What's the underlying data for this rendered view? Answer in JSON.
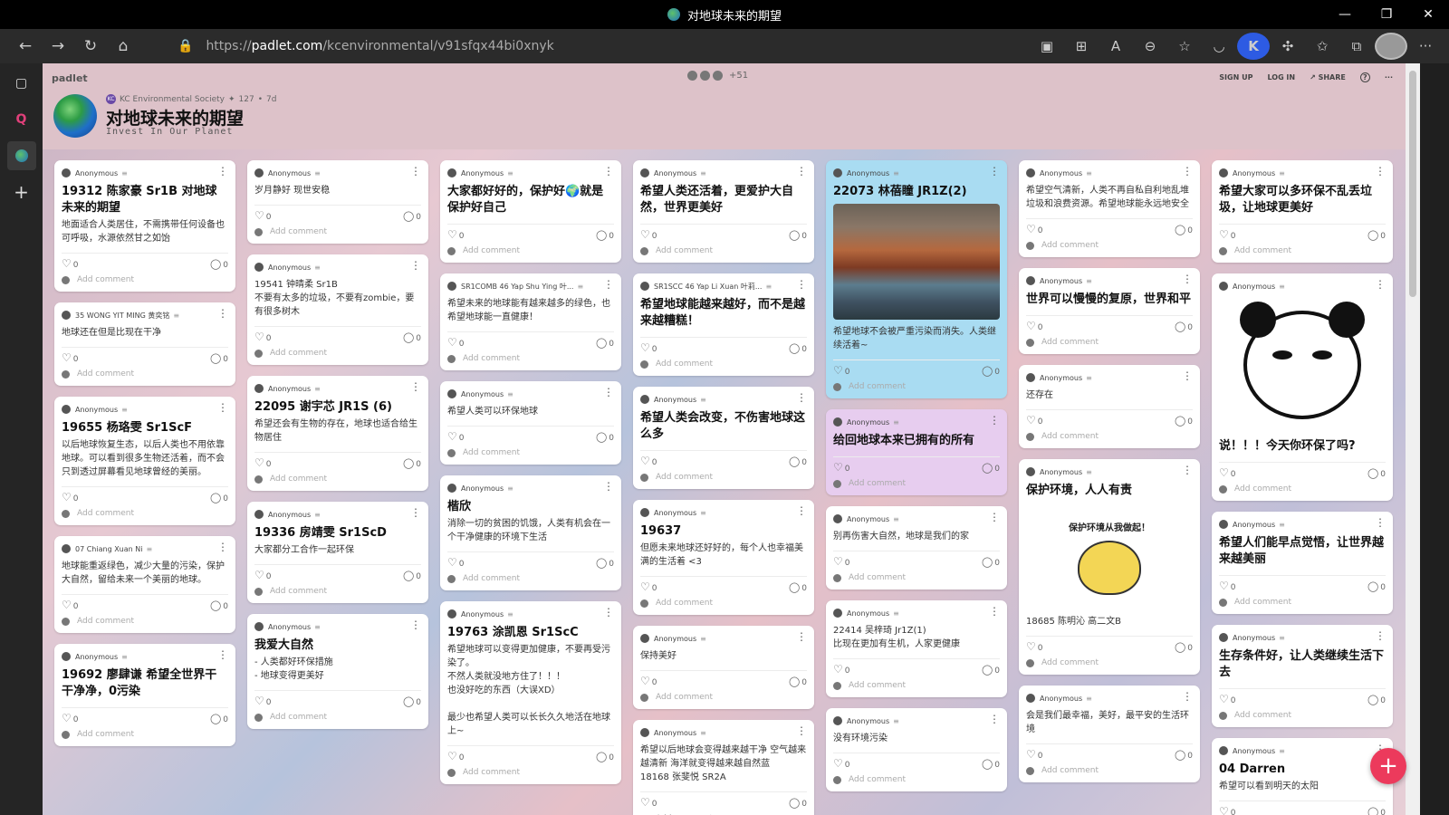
{
  "window": {
    "title": "对地球未来的期望",
    "controls": [
      "—",
      "❐",
      "✕"
    ]
  },
  "browser": {
    "url_prefix": "https://",
    "url_host": "padlet.com",
    "url_path": "/kcenvironmental/v91sfqx44bi0xnyk",
    "back": "←",
    "forward": "→",
    "reload": "↻",
    "home": "⌂",
    "lock": "🔒",
    "menu": "···"
  },
  "sidebar": {
    "tabs": [
      "▢",
      "Q",
      "●"
    ],
    "add": "+"
  },
  "header": {
    "brand": "padlet",
    "contrib_count": "+51",
    "actions": {
      "signup": "SIGN UP",
      "login": "LOG IN",
      "share": "SHARE",
      "help": "?",
      "more": "···"
    },
    "meta_badge": "KC",
    "author": "KC Environmental Society",
    "likes": "127",
    "age": "7d",
    "title": "对地球未来的期望",
    "subtitle": "Invest In Our Planet"
  },
  "comment_placeholder": "Add comment",
  "columns": [
    [
      {
        "author": "Anonymous",
        "title": "19312 陈家豪 Sr1B 对地球未来的期望",
        "body": "地面适合人类居住，不需携带任何设备也可呼吸，水源依然甘之如饴",
        "likes": "0",
        "comments": "0"
      },
      {
        "author": "35 WONG YIT MING 黄奕铭",
        "body": "地球还在但是比现在干净",
        "likes": "0",
        "comments": "0"
      },
      {
        "author": "Anonymous",
        "title": "19655 杨珞雯 Sr1ScF",
        "body": "以后地球恢复生态，以后人类也不用依靠地球。可以看到很多生物还活着，而不会只到透过屏幕看见地球曾经的美丽。",
        "likes": "0",
        "comments": "0"
      },
      {
        "author": "07 Chiang Xuan Ni",
        "body": "地球能重返绿色，减少大量的污染，保护大自然，留给未来一个美丽的地球。",
        "likes": "0",
        "comments": "0"
      },
      {
        "author": "Anonymous",
        "title": "19692 廖肆谦 希望全世界干干净净，0污染",
        "likes": "0",
        "comments": "0"
      }
    ],
    [
      {
        "author": "Anonymous",
        "body": "岁月静好 现世安稳",
        "likes": "0",
        "comments": "0"
      },
      {
        "author": "Anonymous",
        "body": "19541 钟晴柔 Sr1B\n不要有太多的垃圾，不要有zombie，要有很多树木",
        "likes": "0",
        "comments": "0"
      },
      {
        "author": "Anonymous",
        "title": "22095 谢宇芯 JR1S (6)",
        "body": "希望还会有生物的存在，地球也适合给生物居住",
        "likes": "0",
        "comments": "0"
      },
      {
        "author": "Anonymous",
        "title": "19336 房靖雯 Sr1ScD",
        "body": "大家都分工合作一起环保",
        "likes": "0",
        "comments": "0"
      },
      {
        "author": "Anonymous",
        "title": "我爱大自然",
        "body": "- 人类都好环保措施\n- 地球变得更美好",
        "likes": "0",
        "comments": "0"
      }
    ],
    [
      {
        "author": "Anonymous",
        "title": "大家都好好的，保护好🌍就是保护好自己",
        "likes": "0",
        "comments": "0"
      },
      {
        "author": "SR1COMB 46 Yap Shu Ying 叶...",
        "body": "希望未来的地球能有越来越多的绿色，也希望地球能一直健康！",
        "likes": "0",
        "comments": "0"
      },
      {
        "author": "Anonymous",
        "body": "希望人类可以环保地球",
        "likes": "0",
        "comments": "0"
      },
      {
        "author": "Anonymous",
        "title": "楷欣",
        "body": "消除一切的贫困的饥饿，人类有机会在一个干净健康的环境下生活",
        "likes": "0",
        "comments": "0"
      },
      {
        "author": "Anonymous",
        "title": "19763 涂凯恩 Sr1ScC",
        "body": "希望地球可以变得更加健康，不要再受污染了。\n不然人类就没地方住了！！！\n也没好吃的东西（大误XD）\n\n最少也希望人类可以长长久久地活在地球上~",
        "likes": "0",
        "comments": "0"
      }
    ],
    [
      {
        "author": "Anonymous",
        "title": "希望人类还活着，更爱护大自然，世界更美好",
        "likes": "0",
        "comments": "0"
      },
      {
        "author": "SR1SCC 46 Yap Li Xuan 叶莉...",
        "title": "希望地球能越来越好，而不是越来越糟糕！",
        "likes": "0",
        "comments": "0"
      },
      {
        "author": "Anonymous",
        "title": "希望人类会改变，不伤害地球这么多",
        "likes": "0",
        "comments": "0"
      },
      {
        "author": "Anonymous",
        "title": "19637",
        "body": "但愿未来地球还好好的，每个人也幸福美满的生活着 <3",
        "likes": "0",
        "comments": "0"
      },
      {
        "author": "Anonymous",
        "body": "保持美好",
        "likes": "0",
        "comments": "0"
      },
      {
        "author": "Anonymous",
        "body": "希望以后地球会变得越来越干净 空气越来越清新 海洋就变得越来越自然蓝\n18168 张斐悦 SR2A",
        "likes": "0",
        "comments": "0"
      }
    ],
    [
      {
        "author": "Anonymous",
        "title": "22073 林蓓瞳 JR1Z(2)",
        "photo": true,
        "body": "希望地球不会被严重污染而消失。人类继续活着~",
        "likes": "0",
        "comments": "0",
        "color": "blue"
      },
      {
        "author": "Anonymous",
        "title": "给回地球本来已拥有的所有",
        "likes": "0",
        "comments": "0",
        "color": "purple"
      },
      {
        "author": "Anonymous",
        "body": "别再伤害大自然，地球是我们的家",
        "likes": "0",
        "comments": "0"
      },
      {
        "author": "Anonymous",
        "body": "22414 吴梓琦 Jr1Z(1)\n比现在更加有生机，人家更健康",
        "likes": "0",
        "comments": "0"
      },
      {
        "author": "Anonymous",
        "body": "没有环境污染",
        "likes": "0",
        "comments": "0"
      }
    ],
    [
      {
        "author": "Anonymous",
        "body": "希望空气清新，人类不再自私自利地乱堆垃圾和浪费资源。希望地球能永远地安全",
        "likes": "0",
        "comments": "0"
      },
      {
        "author": "Anonymous",
        "title": "世界可以慢慢的复原，世界和平",
        "likes": "0",
        "comments": "0"
      },
      {
        "author": "Anonymous",
        "body": "还存在",
        "likes": "0",
        "comments": "0"
      },
      {
        "author": "Anonymous",
        "title": "保护环境，人人有责",
        "sticker": "保护环境从我做起！",
        "body": "18685 陈明沁 高二文B",
        "likes": "0",
        "comments": "0"
      },
      {
        "author": "Anonymous",
        "body": "会是我们最幸福，美好，最平安的生活环境",
        "likes": "0",
        "comments": "0"
      }
    ],
    [
      {
        "author": "Anonymous",
        "title": "希望大家可以多环保不乱丢垃圾，让地球更美好",
        "likes": "0",
        "comments": "0"
      },
      {
        "author": "Anonymous",
        "panda": true,
        "title": "说！！！今天你环保了吗?",
        "likes": "0",
        "comments": "0"
      },
      {
        "author": "Anonymous",
        "title": "希望人们能早点觉悟，让世界越来越美丽",
        "likes": "0",
        "comments": "0"
      },
      {
        "author": "Anonymous",
        "title": "生存条件好，让人类继续生活下去",
        "likes": "0",
        "comments": "0"
      },
      {
        "author": "Anonymous",
        "title": "04 Darren",
        "body": "希望可以看到明天的太阳",
        "likes": "0",
        "comments": "0"
      }
    ]
  ],
  "fab": "+"
}
